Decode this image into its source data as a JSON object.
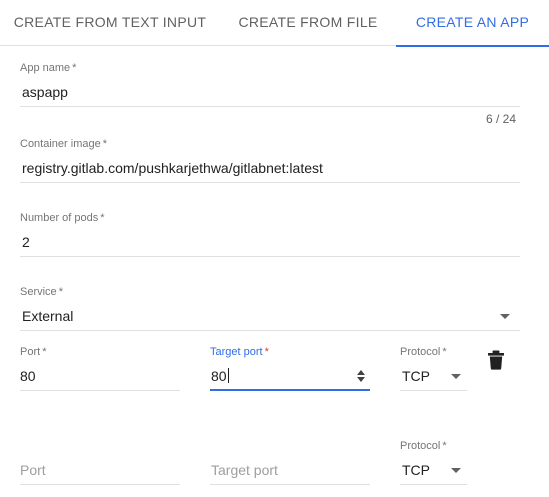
{
  "tabs": [
    {
      "label": "CREATE FROM TEXT INPUT"
    },
    {
      "label": "CREATE FROM FILE"
    },
    {
      "label": "CREATE AN APP"
    }
  ],
  "form": {
    "app_name": {
      "label": "App name",
      "required": "*",
      "value": "aspapp",
      "counter": "6 / 24"
    },
    "container_image": {
      "label": "Container image",
      "required": "*",
      "value": "registry.gitlab.com/pushkarjethwa/gitlabnet:latest"
    },
    "pods": {
      "label": "Number of pods",
      "required": "*",
      "value": "2"
    },
    "service": {
      "label": "Service",
      "required": "*",
      "value": "External"
    },
    "port_row_1": {
      "port": {
        "label": "Port",
        "required": "*",
        "value": "80"
      },
      "target_port": {
        "label": "Target port",
        "required": "*",
        "value": "80"
      },
      "protocol": {
        "label": "Protocol",
        "required": "*",
        "value": "TCP"
      }
    },
    "port_row_2": {
      "port": {
        "placeholder": "Port"
      },
      "target_port": {
        "placeholder": "Target port"
      },
      "protocol": {
        "label": "Protocol",
        "required": "*",
        "value": "TCP"
      }
    }
  },
  "colors": {
    "accent": "#326de6",
    "required_focused": "#e53935"
  },
  "icons": {
    "delete": "trash-icon",
    "dropdown": "caret-down-icon",
    "spinner": "number-spinner-icon"
  }
}
